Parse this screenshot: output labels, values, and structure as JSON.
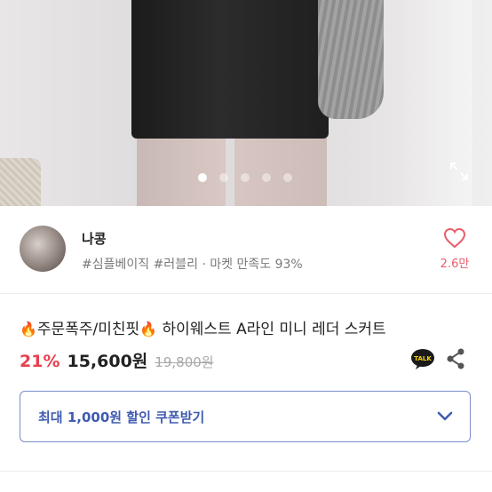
{
  "gallery": {
    "dot_count": 5,
    "active_index": 0
  },
  "seller": {
    "name": "나콩",
    "tags": "#심플베이직 #러블리 · 마켓 만족도 93%",
    "like_count": "2.6만"
  },
  "product": {
    "title": "주문폭주/미친핏",
    "title_rest": "하이웨스트 A라인 미니 레더 스커트",
    "fire_emoji": "🔥",
    "discount": "21%",
    "price": "15,600원",
    "original_price": "19,800원"
  },
  "coupon": {
    "label": "최대 1,000원 할인 쿠폰받기"
  },
  "colors": {
    "accent_red": "#e8404f",
    "coupon_blue": "#3f5bb0",
    "heart": "#e85d6a"
  },
  "icons": {
    "expand": "expand-icon",
    "heart": "heart-icon",
    "talk": "kakao-talk-icon",
    "share": "share-icon",
    "chevron": "chevron-down-icon"
  }
}
